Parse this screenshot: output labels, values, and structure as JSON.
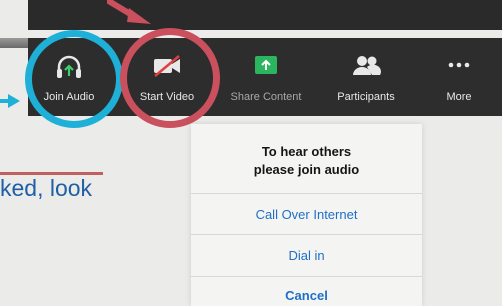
{
  "toolbar": {
    "items": [
      {
        "label": "Join Audio",
        "icon": "headphones-icon"
      },
      {
        "label": "Start Video",
        "icon": "camera-off-icon"
      },
      {
        "label": "Share Content",
        "icon": "share-screen-icon"
      },
      {
        "label": "Participants",
        "icon": "people-icon"
      },
      {
        "label": "More",
        "icon": "more-dots-icon"
      }
    ]
  },
  "background": {
    "partial_text": "ked, look"
  },
  "popup": {
    "title": "To hear others please join audio",
    "title_line1": "To hear others",
    "title_line2": "please join audio",
    "options": [
      "Call Over Internet",
      "Dial in",
      "Cancel"
    ]
  },
  "colors": {
    "toolbar_bg": "#2d2d2d",
    "highlight_blue": "#1fb0d8",
    "highlight_red": "#c9505c",
    "share_green": "#2cb55f",
    "link_blue": "#1f6fc8"
  }
}
